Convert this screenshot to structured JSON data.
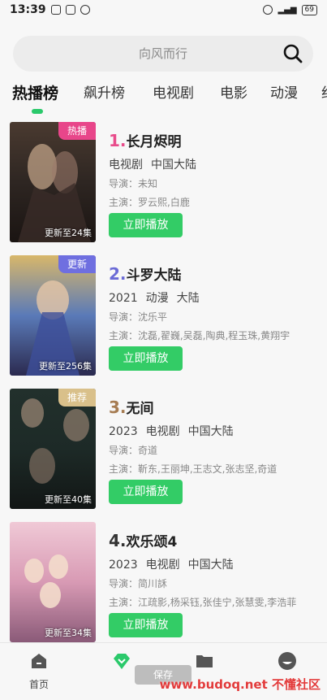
{
  "status": {
    "time": "13:39",
    "battery": "69"
  },
  "search": {
    "placeholder": "向风而行"
  },
  "tabs": [
    {
      "label": "热播榜",
      "active": true
    },
    {
      "label": "飙升榜"
    },
    {
      "label": "电视剧"
    },
    {
      "label": "电影"
    },
    {
      "label": "动漫"
    },
    {
      "label": "纪"
    }
  ],
  "items": [
    {
      "rank": "1.",
      "rank_color": "#e84c8b",
      "title": "长月烬明",
      "year": "",
      "genre": "电视剧",
      "region": "中国大陆",
      "director": "导演：未知",
      "actors": "主演：罗云熙,白鹿",
      "badge": "热播",
      "badge_color": "#e8468a",
      "update": "更新至24集",
      "play_label": "立即播放"
    },
    {
      "rank": "2.",
      "rank_color": "#6b6bd6",
      "title": "斗罗大陆",
      "year": "2021",
      "genre": "动漫",
      "region": "大陆",
      "director": "导演：沈乐平",
      "actors": "主演：沈磊,翟巍,吴磊,陶典,程玉珠,黄翔宇",
      "badge": "更新",
      "badge_color": "#6f6fe0",
      "update": "更新至256集",
      "play_label": "立即播放"
    },
    {
      "rank": "3.",
      "rank_color": "#a67c52",
      "title": "无间",
      "year": "2023",
      "genre": "电视剧",
      "region": "中国大陆",
      "director": "导演：奇道",
      "actors": "主演：靳东,王丽坤,王志文,张志坚,奇道",
      "badge": "推荐",
      "badge_color": "#d9c08a",
      "update": "更新至40集",
      "play_label": "立即播放"
    },
    {
      "rank": "4.",
      "rank_color": "#333333",
      "title": "欢乐颂4",
      "year": "2023",
      "genre": "电视剧",
      "region": "中国大陆",
      "director": "导演：简川訸",
      "actors": "主演：江疏影,杨采钰,张佳宁,张慧雯,李浩菲",
      "badge": "",
      "badge_color": "",
      "update": "更新至34集",
      "play_label": "立即播放"
    }
  ],
  "nav": [
    {
      "label": "首页",
      "icon": "home-icon"
    },
    {
      "label": "",
      "icon": "diamond-icon"
    },
    {
      "label": "",
      "icon": "folder-icon"
    },
    {
      "label": "",
      "icon": "profile-icon"
    }
  ],
  "toast": "保存",
  "watermark": "www.budoq.net 不懂社区",
  "colors": {
    "accent": "#33cc66",
    "indicator": "#2bc96b"
  }
}
